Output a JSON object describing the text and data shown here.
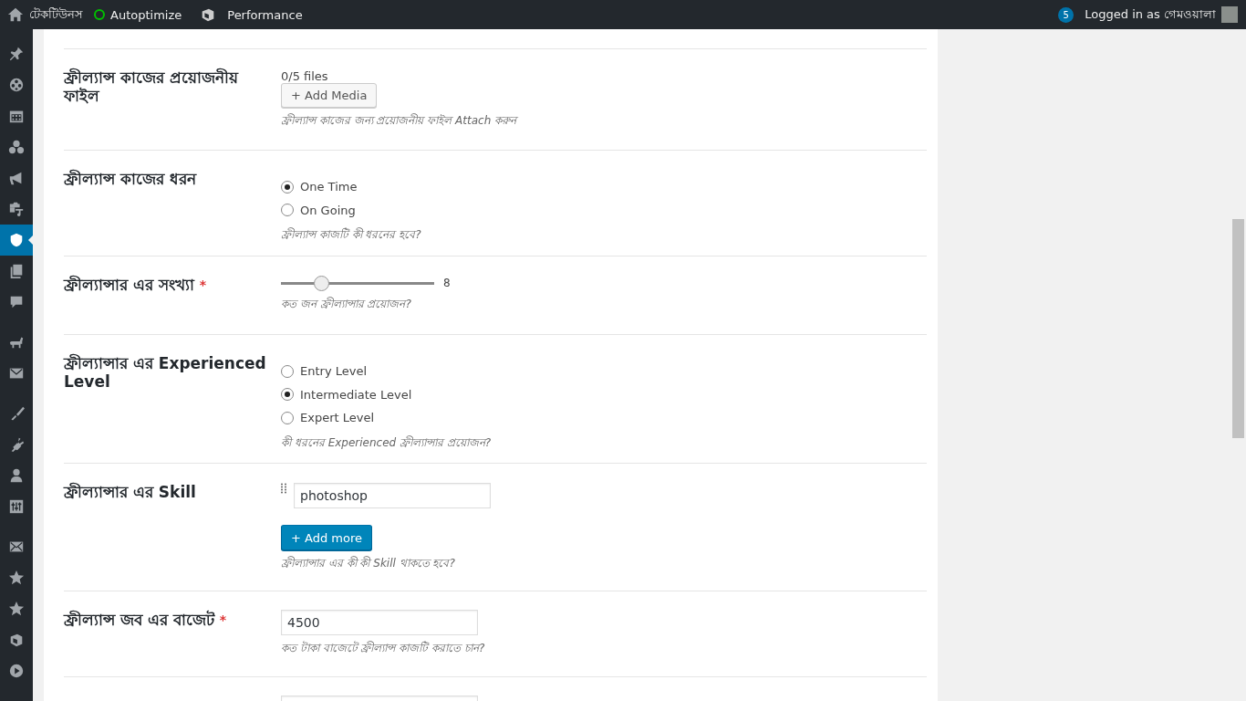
{
  "admin_bar": {
    "items": [
      {
        "kind": "home",
        "label": "টেকটিউনস"
      },
      {
        "kind": "status",
        "label": "Autoptimize",
        "color": "#00c000"
      },
      {
        "kind": "cube",
        "label": "Performance"
      }
    ],
    "notifications": "5",
    "account": "Logged in as গেমওয়ালা"
  },
  "sidebar": {
    "items": [
      {
        "kind": "pin",
        "selected": false
      },
      {
        "kind": "film",
        "selected": false
      },
      {
        "kind": "calendar",
        "selected": false
      },
      {
        "kind": "groups",
        "selected": false
      },
      {
        "kind": "megaphone",
        "selected": false
      },
      {
        "kind": "media",
        "selected": false
      },
      {
        "kind": "shield",
        "selected": true
      },
      {
        "kind": "pages",
        "selected": false
      },
      {
        "kind": "comment",
        "selected": false
      },
      {
        "kind": "separator"
      },
      {
        "kind": "animal",
        "selected": false
      },
      {
        "kind": "mail",
        "selected": false
      },
      {
        "kind": "separator"
      },
      {
        "kind": "brush",
        "selected": false
      },
      {
        "kind": "plug",
        "selected": false
      },
      {
        "kind": "user",
        "selected": false
      },
      {
        "kind": "sliders",
        "selected": false
      },
      {
        "kind": "separator"
      },
      {
        "kind": "envelope",
        "selected": false
      },
      {
        "kind": "star",
        "selected": false
      },
      {
        "kind": "star",
        "selected": false
      },
      {
        "kind": "cube",
        "selected": false
      },
      {
        "kind": "play",
        "selected": false
      }
    ]
  },
  "form": {
    "rows": [
      {
        "kind": "media",
        "label": "ফ্রীল্যান্স কাজের প্রয়োজনীয় ফাইল",
        "count": "0/5 files",
        "button": "+ Add Media",
        "description": "ফ্রীল্যান্স কাজের জন্য প্রয়োজনীয় ফাইল Attach করুন"
      },
      {
        "kind": "radio",
        "label": "ফ্রীল্যান্স কাজের ধরন",
        "options": [
          {
            "label": "One Time",
            "selected": true
          },
          {
            "label": "On Going",
            "selected": false
          }
        ],
        "description": "ফ্রীল্যান্স কাজটি কী ধরনের হবে?"
      },
      {
        "kind": "slider",
        "label": "ফ্রীল্যান্সার এর সংখ্যা",
        "required_mark": "*",
        "level": 0.26,
        "reading": "8",
        "description": "কত জন ফ্রীল্যান্সার প্রয়োজন?"
      },
      {
        "kind": "radio",
        "label": "ফ্রীল্যান্সার এর Experienced Level",
        "options": [
          {
            "label": "Entry Level",
            "selected": false
          },
          {
            "label": "Intermediate Level",
            "selected": true
          },
          {
            "label": "Expert Level",
            "selected": false
          }
        ],
        "description": "কী ধরনের Experienced ফ্রীল্যান্সার প্রয়োজন?"
      },
      {
        "kind": "repeater",
        "label": "ফ্রীল্যান্সার এর Skill",
        "values": [
          "photoshop"
        ],
        "button": "+ Add more",
        "description": "ফ্রীল্যান্সার এর কী কী Skill থাকতে হবে?"
      },
      {
        "kind": "text",
        "label": "ফ্রীল্যান্স জব এর বাজেট",
        "required_mark": "*",
        "value": "4500",
        "description": "কত টাকা বাজেটে ফ্রীল্যান্স কাজটি করাতে চান?"
      },
      {
        "kind": "text"
      }
    ]
  }
}
